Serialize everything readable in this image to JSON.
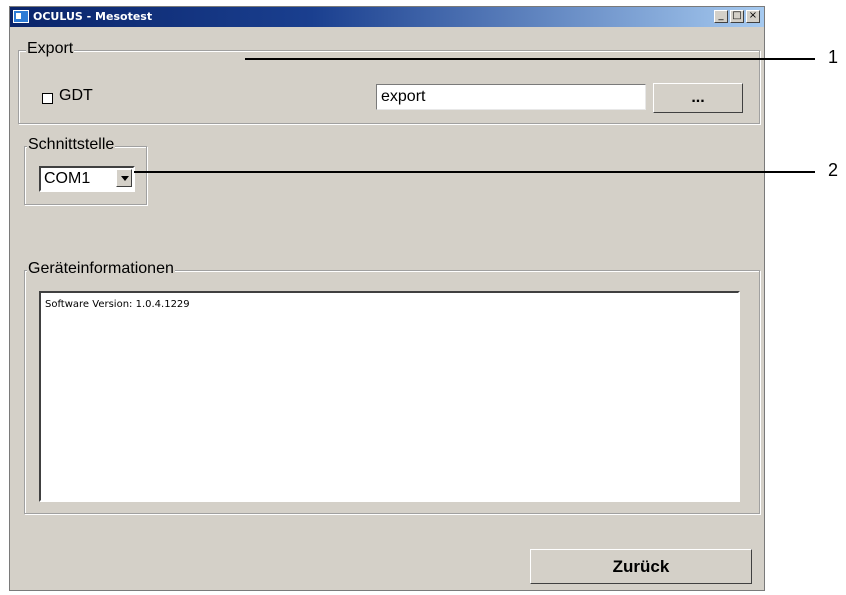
{
  "window": {
    "title": "OCULUS - Mesotest",
    "controls": {
      "minimize": "_",
      "maximize": "□",
      "close": "×"
    }
  },
  "export_group": {
    "legend": "Export",
    "gdt_checkbox_label": "GDT",
    "gdt_checked": false,
    "path_value": "export",
    "browse_label": "..."
  },
  "interface_group": {
    "legend": "Schnittstelle",
    "port_selected": "COM1"
  },
  "device_info_group": {
    "legend": "Geräteinformationen",
    "text": "Software Version: 1.0.4.1229"
  },
  "back_button_label": "Zurück",
  "callouts": [
    "1",
    "2"
  ]
}
